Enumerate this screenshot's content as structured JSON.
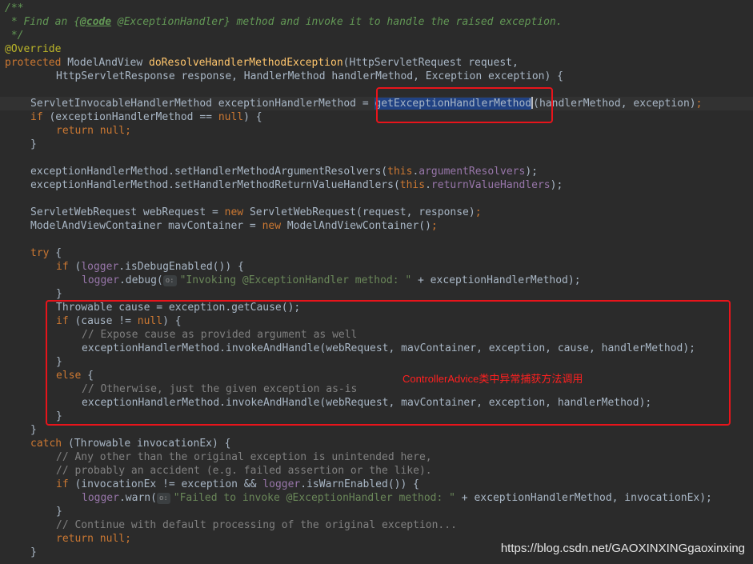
{
  "editor": {
    "code": {
      "l1": "/**",
      "l2a": " * Find an {",
      "l2tag": "@code",
      "l2b": " @ExceptionHandler} method and invoke it to handle the raised exception.",
      "l3": " */",
      "l4": "@Override",
      "l5kw": "protected",
      "l5a": " ModelAndView ",
      "l5fn": "doResolveHandlerMethodException",
      "l5b": "(HttpServletRequest request,",
      "l6": "HttpServletResponse response, HandlerMethod handlerMethod, Exception exception) {",
      "l7a": "ServletInvocableHandlerMethod exceptionHandlerMethod = ",
      "l7sel": "getExceptionHandlerMethod",
      "l7b": "(handlerMethod, exception)",
      "l8kw": "if",
      "l8a": " (exceptionHandlerMethod == ",
      "l8null": "null",
      "l8b": ") {",
      "l9kw": "return",
      "l9null": " null",
      "l10": "}",
      "l11a": "exceptionHandlerMethod.setHandlerMethodArgumentResolvers(",
      "l11this": "this",
      "l11dot": ".",
      "l11field": "argumentResolvers",
      "l11b": ");",
      "l12a": "exceptionHandlerMethod.setHandlerMethodReturnValueHandlers(",
      "l12this": "this",
      "l12dot": ".",
      "l12field": "returnValueHandlers",
      "l12b": ");",
      "l13a": "ServletWebRequest webRequest = ",
      "l13new": "new",
      "l13b": " ServletWebRequest(request, response)",
      "l14a": "ModelAndViewContainer mavContainer = ",
      "l14new": "new",
      "l14b": " ModelAndViewContainer()",
      "l15kw": "try",
      "l15b": " {",
      "l16kw": "if",
      "l16a": " (",
      "l16field": "logger",
      "l16b": ".isDebugEnabled()) {",
      "l17field": "logger",
      "l17a": ".debug(",
      "l17hint": "o:",
      "l17str": "\"Invoking @ExceptionHandler method: \"",
      "l17b": " + exceptionHandlerMethod);",
      "l18": "}",
      "l19": "Throwable cause = exception.getCause();",
      "l20kw": "if",
      "l20a": " (cause != ",
      "l20null": "null",
      "l20b": ") {",
      "l21": "// Expose cause as provided argument as well",
      "l22": "exceptionHandlerMethod.invokeAndHandle(webRequest, mavContainer, exception, cause, handlerMethod);",
      "l23": "}",
      "l24kw": "else",
      "l24b": " {",
      "l25": "// Otherwise, just the given exception as-is",
      "l26": "exceptionHandlerMethod.invokeAndHandle(webRequest, mavContainer, exception, handlerMethod);",
      "l27": "}",
      "l28": "}",
      "l29kw": "catch",
      "l29b": " (Throwable invocationEx) {",
      "l30": "// Any other than the original exception is unintended here,",
      "l31": "// probably an accident (e.g. failed assertion or the like).",
      "l32kw": "if",
      "l32a": " (invocationEx != exception && ",
      "l32field": "logger",
      "l32b": ".isWarnEnabled()) {",
      "l33field": "logger",
      "l33a": ".warn(",
      "l33hint": "o:",
      "l33str": "\"Failed to invoke @ExceptionHandler method: \"",
      "l33b": " + exceptionHandlerMethod, invocationEx);",
      "l34": "}",
      "l35": "// Continue with default processing of the original exception...",
      "l36kw": "return",
      "l36null": " null",
      "l37": "}",
      "semi": ";"
    }
  },
  "annotation": {
    "note": "ControllerAdvice类中异常捕获方法调用"
  },
  "watermark": "https://blog.csdn.net/GAOXINXINGgaoxinxing",
  "colors": {
    "background": "#2b2b2b",
    "keyword": "#cc7832",
    "method_decl": "#ffc66d",
    "string": "#6a8759",
    "comment": "#808080",
    "doc_comment": "#629755",
    "field": "#9876aa",
    "annotation": "#bbb529",
    "highlight_box": "#e8141b"
  }
}
